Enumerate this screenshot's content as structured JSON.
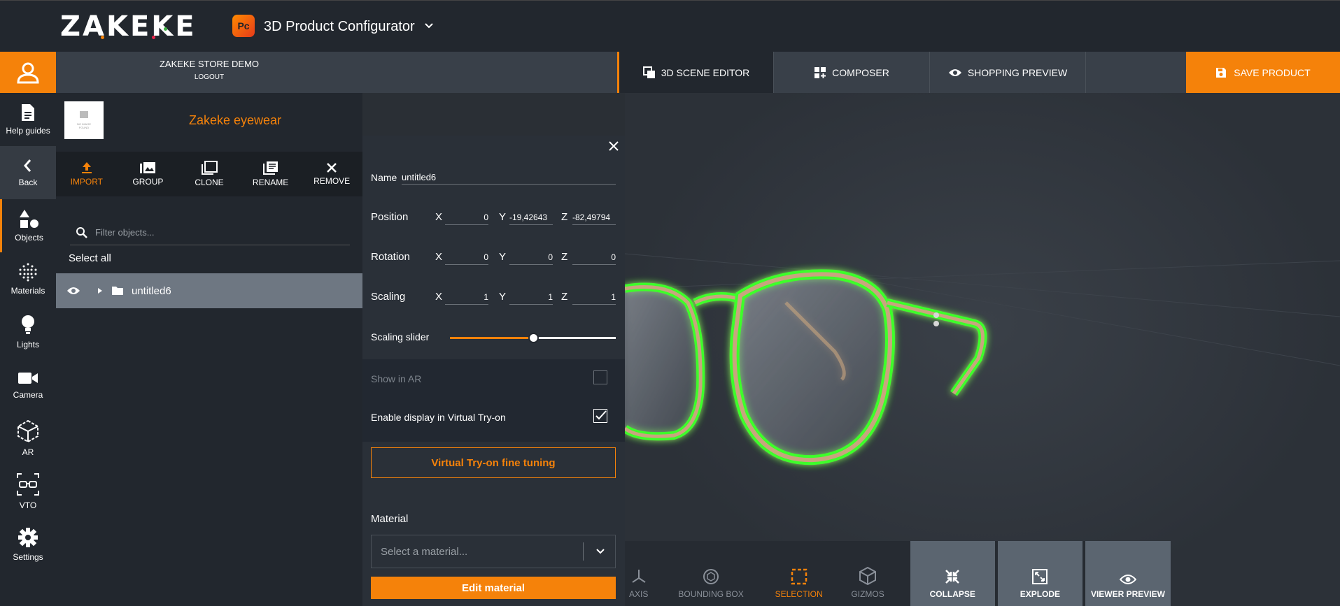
{
  "header": {
    "logo_text": "ZAKEKE",
    "app_icon_text": "Pc",
    "app_title": "3D Product Configurator"
  },
  "store": {
    "name": "ZAKEKE STORE DEMO",
    "logout": "LOGOUT"
  },
  "tabs": [
    {
      "label": "3D SCENE EDITOR",
      "icon": "layers-icon"
    },
    {
      "label": "COMPOSER",
      "icon": "composer-icon"
    },
    {
      "label": "SHOPPING PREVIEW",
      "icon": "eye-icon"
    }
  ],
  "save_label": "SAVE PRODUCT",
  "leftnav": [
    {
      "label": "Help guides",
      "icon": "document-icon"
    },
    {
      "label": "Back",
      "icon": "chevron-left-icon"
    },
    {
      "label": "Objects",
      "icon": "shapes-icon"
    },
    {
      "label": "Materials",
      "icon": "dots-sphere-icon"
    },
    {
      "label": "Lights",
      "icon": "bulb-icon"
    },
    {
      "label": "Camera",
      "icon": "camera-icon"
    },
    {
      "label": "AR",
      "icon": "cube-icon"
    },
    {
      "label": "VTO",
      "icon": "glasses-icon"
    },
    {
      "label": "Settings",
      "icon": "gear-icon"
    }
  ],
  "objects": {
    "thumb_text": "NO IMAGE FOUND",
    "title": "Zakeke eyewear",
    "tools": [
      "IMPORT",
      "GROUP",
      "CLONE",
      "RENAME",
      "REMOVE"
    ],
    "filter_placeholder": "Filter objects...",
    "select_all": "Select all",
    "items": [
      {
        "name": "untitled6"
      }
    ]
  },
  "props": {
    "name_label": "Name",
    "name_value": "untitled6",
    "position_label": "Position",
    "rotation_label": "Rotation",
    "scaling_label": "Scaling",
    "axes": [
      "X",
      "Y",
      "Z"
    ],
    "position": [
      "0",
      "-19,42643",
      "-82,49794"
    ],
    "rotation": [
      "0",
      "0",
      "0"
    ],
    "scaling": [
      "1",
      "1",
      "1"
    ],
    "slider_label": "Scaling slider",
    "slider_value": 0.5,
    "show_ar_label": "Show in AR",
    "show_ar_checked": false,
    "vto_label": "Enable display in Virtual Try-on",
    "vto_checked": true,
    "vto_button": "Virtual Try-on fine tuning",
    "material_label": "Material",
    "material_placeholder": "Select a material...",
    "edit_material": "Edit material"
  },
  "bottom": {
    "axis": "AXIS",
    "bbox": "BOUNDING BOX",
    "selection": "SELECTION",
    "gizmos": "GIZMOS",
    "collapse": "COLLAPSE",
    "explode": "EXPLODE",
    "viewer_preview": "VIEWER PREVIEW"
  },
  "colors": {
    "accent": "#f5820a",
    "selection_glow": "#3cff2a"
  }
}
